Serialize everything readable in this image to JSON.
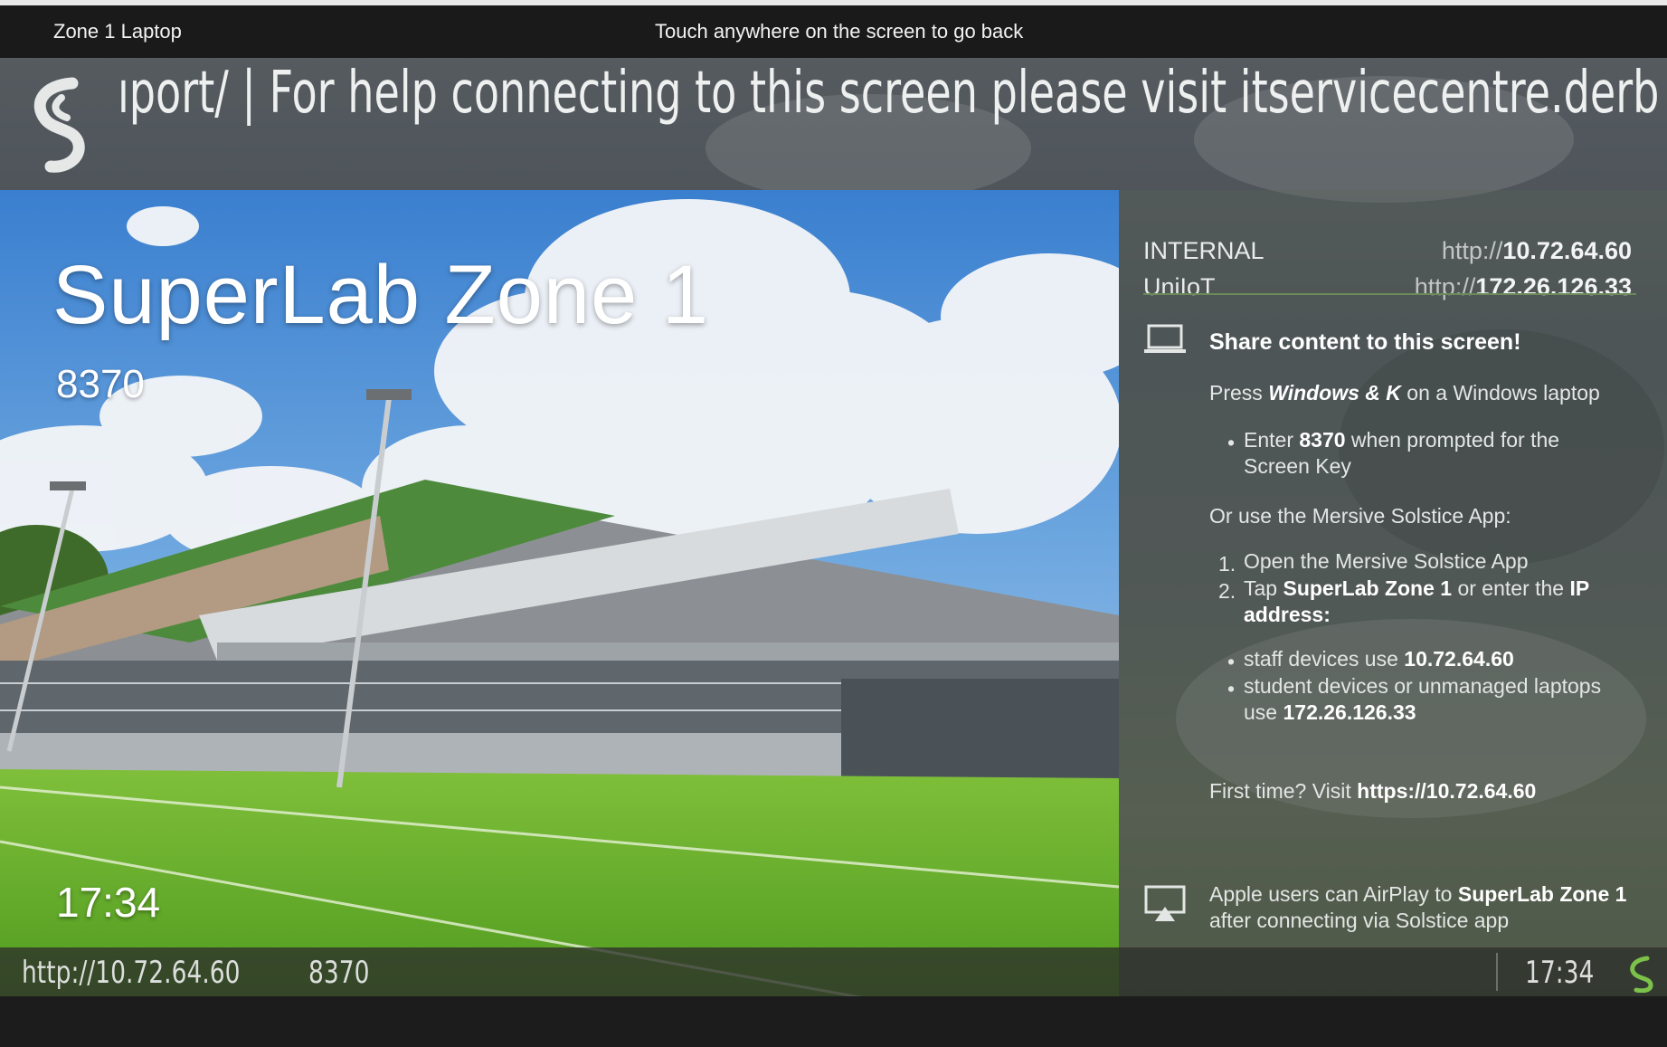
{
  "top_bar": {
    "device_label": "Zone 1 Laptop",
    "hint": "Touch anywhere on the screen to go back"
  },
  "banner": {
    "ticker_text": "ıport/  |  For help connecting to this screen please visit itservicecentre.derb"
  },
  "hero": {
    "room_name": "SuperLab Zone 1",
    "screen_key": "8370",
    "clock": "17:34"
  },
  "panel": {
    "networks": [
      {
        "label": "INTERNAL",
        "protocol": "http://",
        "ip": "10.72.64.60"
      },
      {
        "label": "UniIoT",
        "protocol": "http://",
        "ip": "172.26.126.33"
      }
    ],
    "share_heading": "Share content to this screen!",
    "press_prefix": "Press ",
    "press_keys": "Windows & K",
    "press_suffix": " on a Windows laptop",
    "enter_prefix": "Enter ",
    "enter_key": "8370",
    "enter_suffix_line1": " when prompted for the",
    "enter_suffix_line2": "Screen Key",
    "or_use": "Or use the Mersive Solstice App:",
    "step1_num": "1.",
    "step1": "Open the Mersive Solstice App",
    "step2_num": "2.",
    "step2_prefix": "Tap ",
    "step2_room": "SuperLab Zone 1",
    "step2_mid": " or enter the ",
    "step2_ip": "IP",
    "step2_line2": "address:",
    "staff_prefix": "staff devices use ",
    "staff_ip": "10.72.64.60",
    "student_line1": "student devices or unmanaged laptops",
    "student_prefix": "use ",
    "student_ip": "172.26.126.33",
    "first_time_prefix": "First time? Visit ",
    "first_time_url": "https://10.72.64.60",
    "airplay_prefix": "Apple users can AirPlay to ",
    "airplay_room": "SuperLab Zone 1",
    "airplay_line2": "after connecting via Solstice app"
  },
  "status_bar": {
    "url": "http://10.72.64.60",
    "screen_key": "8370",
    "time": "17:34"
  },
  "icons": {
    "banner_logo": "solstice-logo-icon",
    "share": "laptop-icon",
    "airplay": "airplay-icon",
    "status_logo": "solstice-logo-icon"
  },
  "colors": {
    "accent_green": "#6b8a57",
    "status_logo_green": "#7cc24a"
  }
}
